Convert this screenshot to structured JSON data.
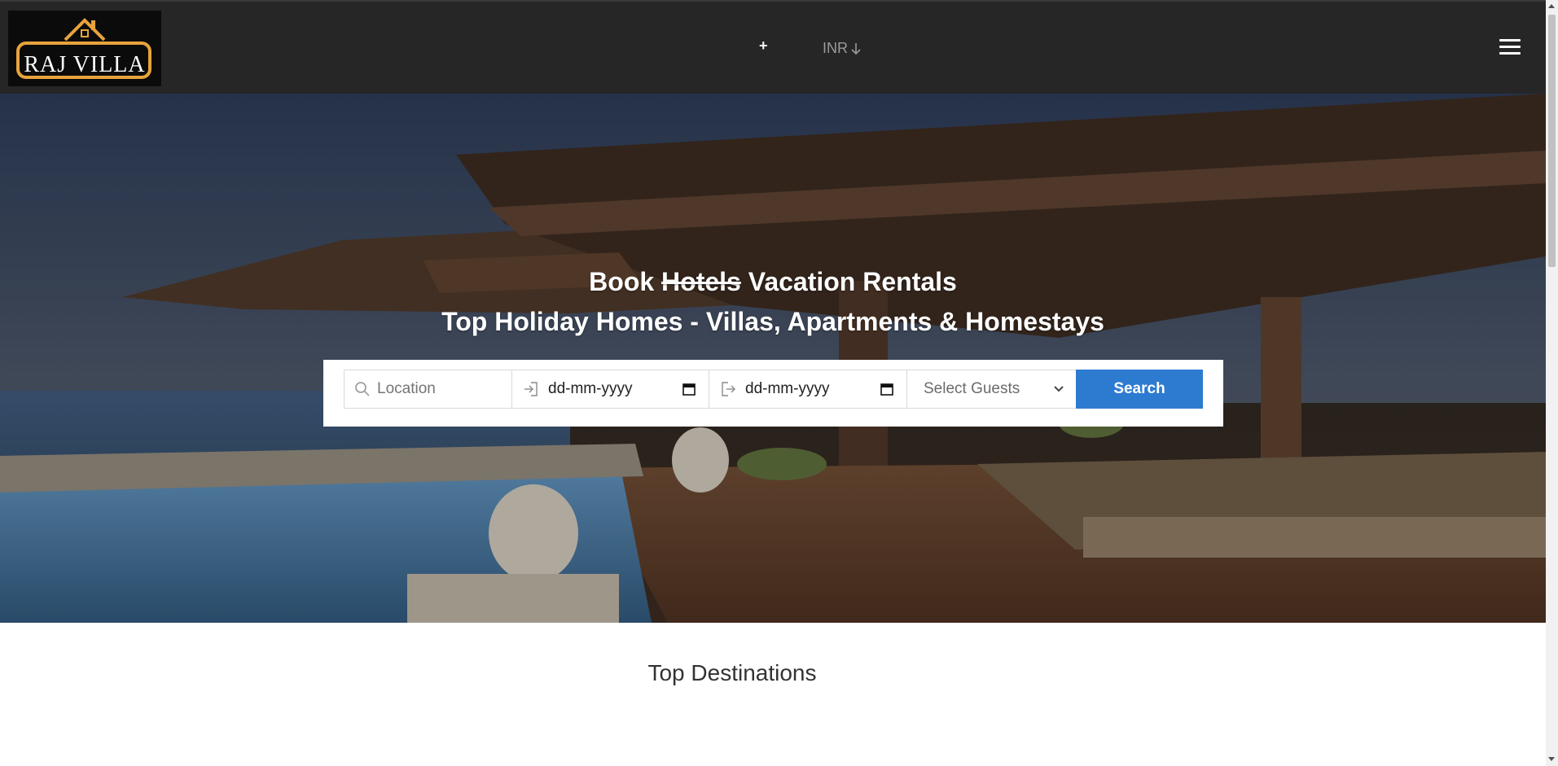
{
  "header": {
    "logo_text": "RAJ VILLA",
    "plus_label": "+",
    "currency_label": "INR",
    "menu_icon": "hamburger-icon"
  },
  "hero": {
    "headline_prefix": "Book",
    "headline_struck": "Hotels",
    "headline_suffix": "Vacation Rentals",
    "subheadline": "Top Holiday Homes - Villas, Apartments & Homestays"
  },
  "search": {
    "location_placeholder": "Location",
    "checkin_placeholder": "dd-mm-yyyy",
    "checkout_placeholder": "dd-mm-yyyy",
    "guests_label": "Select Guests",
    "button_label": "Search"
  },
  "sections": {
    "top_destinations_title": "Top Destinations"
  },
  "colors": {
    "header_bg": "#262626",
    "logo_accent": "#e8a33c",
    "search_button": "#2d7bd1"
  }
}
